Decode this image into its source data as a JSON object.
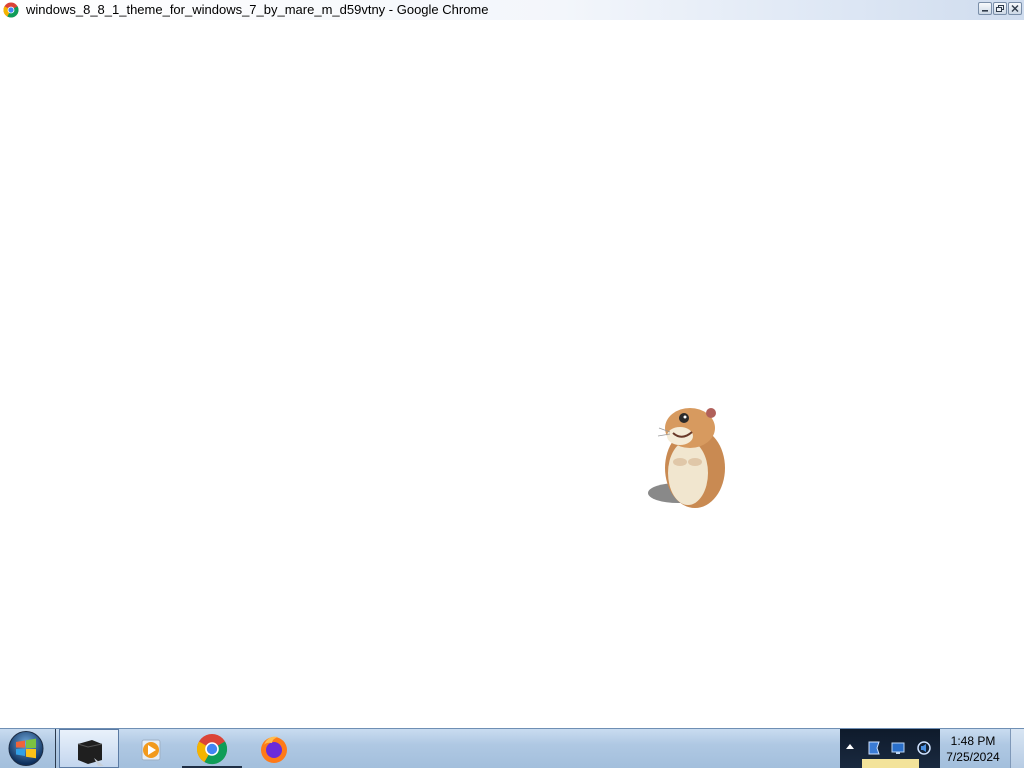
{
  "window": {
    "title": "windows_8_8_1_theme_for_windows_7_by_mare_m_d59vtny - Google Chrome",
    "app_icon": "chrome-icon",
    "controls": [
      "minimize-icon",
      "restore-icon",
      "close-icon"
    ]
  },
  "content": {
    "image": "hamster-image"
  },
  "taskbar": {
    "start_icon": "windows-start-icon",
    "apps": [
      {
        "name": "file-explorer-icon",
        "state": "active"
      },
      {
        "name": "media-player-icon",
        "state": "normal"
      },
      {
        "name": "chrome-icon",
        "state": "running"
      },
      {
        "name": "firefox-icon",
        "state": "normal"
      }
    ],
    "tray_icons": [
      "show-hidden-icons-arrow",
      "action-center-icon",
      "network-icon",
      "volume-icon"
    ],
    "clock": {
      "time": "1:48 PM",
      "date": "7/25/2024"
    }
  },
  "colors": {
    "taskbar": "#afc8e3",
    "tray_background": "#0e1a2b",
    "content_background": "#ffffff"
  }
}
